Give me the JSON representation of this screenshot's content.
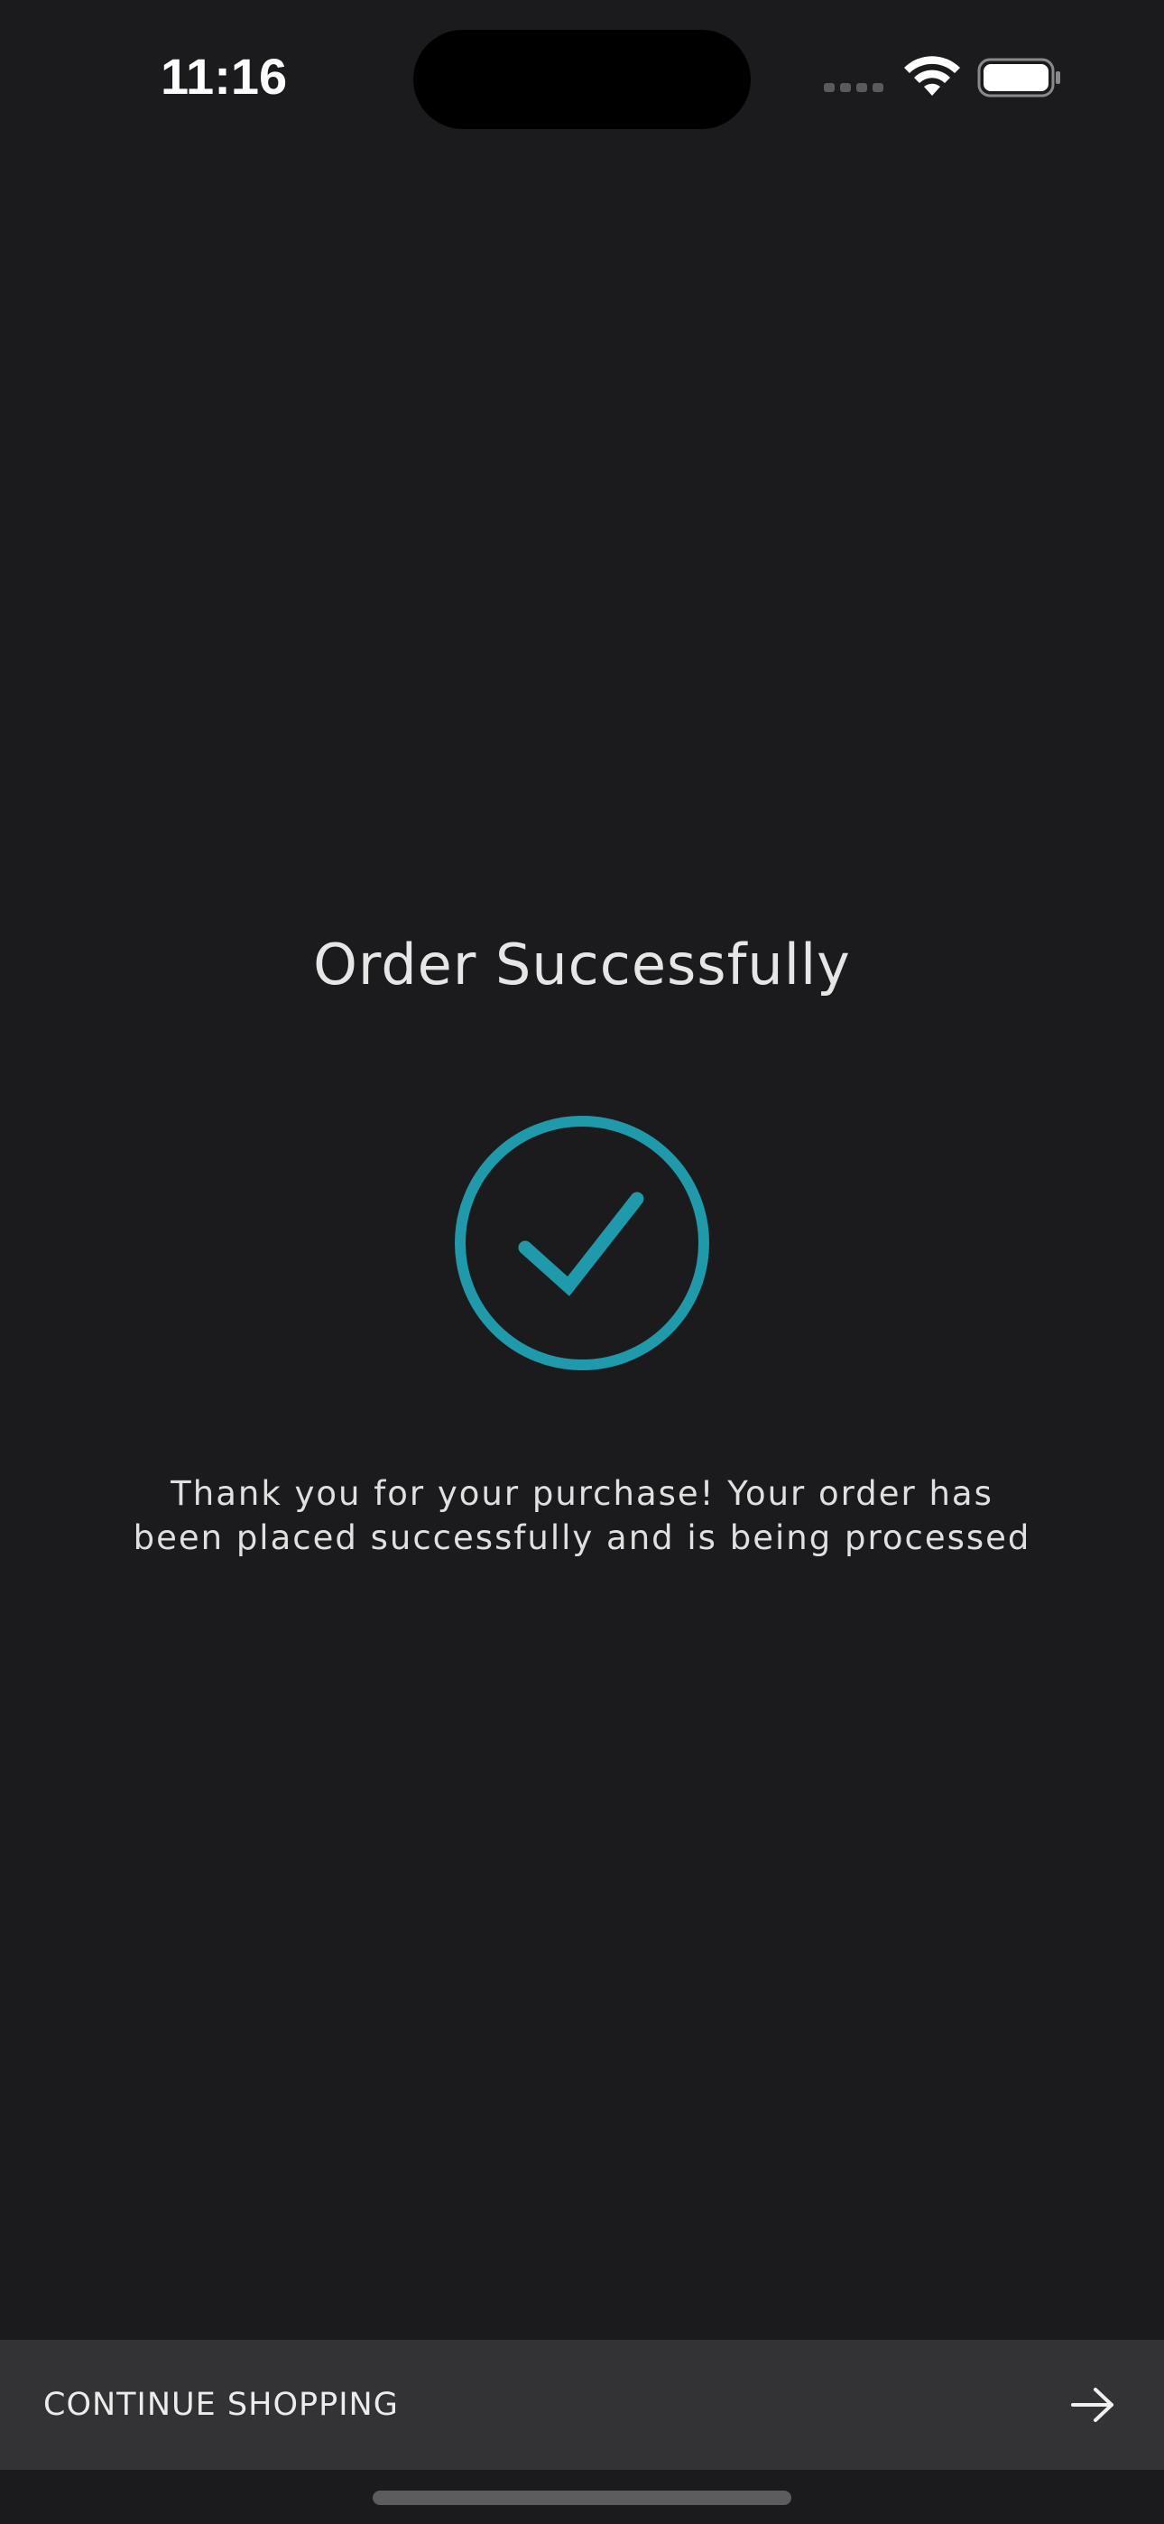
{
  "status_bar": {
    "time": "11:16",
    "icons": [
      "cellular-signal-icon",
      "wifi-icon",
      "battery-icon"
    ]
  },
  "page": {
    "title": "Order Successfully",
    "success_icon": "check-circle-icon",
    "message": "Thank you for your purchase! Your order has been placed successfully and is being processed"
  },
  "footer": {
    "button_label": "CONTINUE SHOPPING",
    "button_icon": "arrow-right-icon"
  },
  "colors": {
    "background": "#1b1b1d",
    "accent": "#1e9aaa",
    "button_background": "#333335"
  }
}
